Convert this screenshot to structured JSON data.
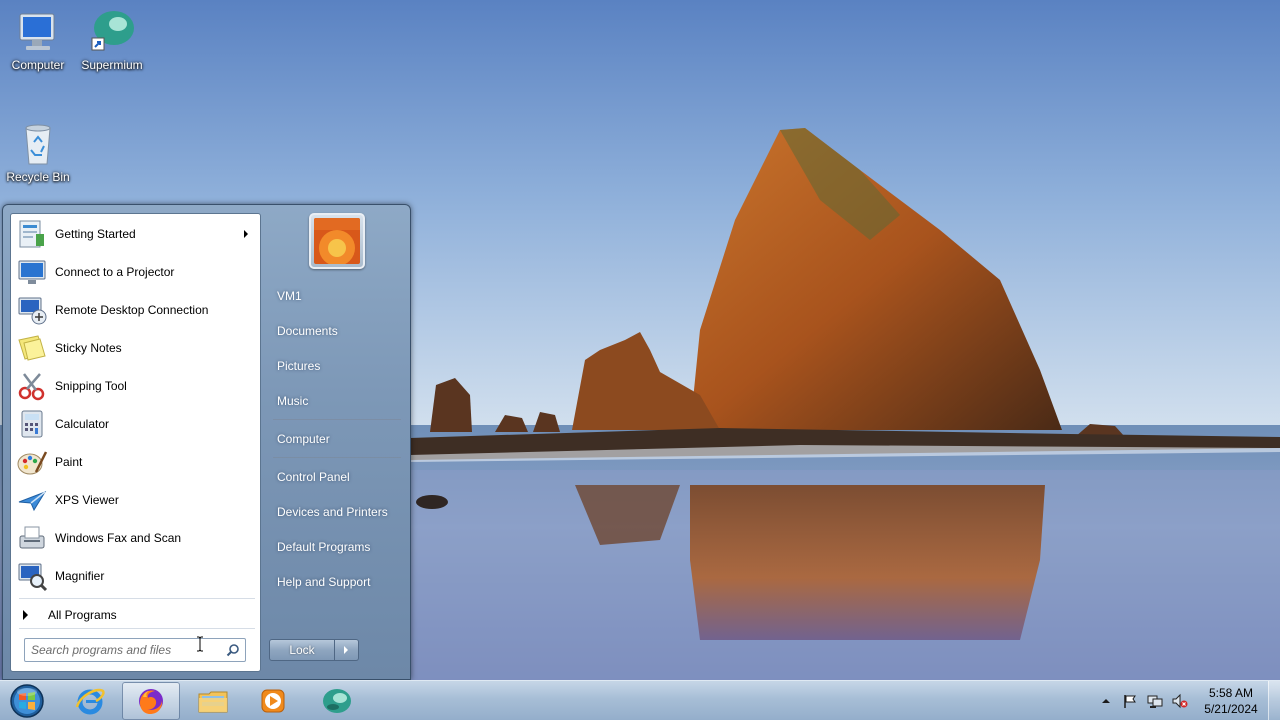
{
  "desktop": {
    "icons": [
      {
        "label": "Computer",
        "icon": "computer-icon"
      },
      {
        "label": "Supermium",
        "icon": "supermium-icon"
      },
      {
        "label": "Recycle Bin",
        "icon": "recycle-bin-icon"
      }
    ]
  },
  "start_menu": {
    "programs": [
      {
        "label": "Getting Started",
        "icon": "getting-started-icon",
        "has_submenu": true
      },
      {
        "label": "Connect to a Projector",
        "icon": "projector-icon"
      },
      {
        "label": "Remote Desktop Connection",
        "icon": "remote-desktop-icon"
      },
      {
        "label": "Sticky Notes",
        "icon": "sticky-notes-icon"
      },
      {
        "label": "Snipping Tool",
        "icon": "snipping-tool-icon"
      },
      {
        "label": "Calculator",
        "icon": "calculator-icon"
      },
      {
        "label": "Paint",
        "icon": "paint-icon"
      },
      {
        "label": "XPS Viewer",
        "icon": "xps-viewer-icon"
      },
      {
        "label": "Windows Fax and Scan",
        "icon": "fax-scan-icon"
      },
      {
        "label": "Magnifier",
        "icon": "magnifier-icon"
      }
    ],
    "all_programs": "All Programs",
    "search": {
      "placeholder": "Search programs and files",
      "value": ""
    },
    "user_picture": "flower-user-picture",
    "right_items": [
      {
        "label": "VM1"
      },
      {
        "label": "Documents"
      },
      {
        "label": "Pictures"
      },
      {
        "label": "Music"
      },
      {
        "label": "Computer"
      },
      {
        "label": "Control Panel"
      },
      {
        "label": "Devices and Printers"
      },
      {
        "label": "Default Programs"
      },
      {
        "label": "Help and Support"
      }
    ],
    "lock_label": "Lock"
  },
  "taskbar": {
    "pinned": [
      {
        "name": "Internet Explorer",
        "icon": "internet-explorer-icon"
      },
      {
        "name": "Firefox",
        "icon": "firefox-icon",
        "active": true
      },
      {
        "name": "Windows Explorer",
        "icon": "file-explorer-icon"
      },
      {
        "name": "Windows Media Player",
        "icon": "media-player-icon"
      },
      {
        "name": "Supermium",
        "icon": "supermium-icon"
      }
    ],
    "tray_icons": [
      "show-hidden-icons-icon",
      "action-center-flag-icon",
      "network-icon",
      "volume-muted-icon"
    ],
    "clock": {
      "time": "5:58 AM",
      "date": "5/21/2024"
    }
  },
  "colors": {
    "sky_top": "#5b86c4",
    "sky_bottom": "#c7d7e9",
    "taskbar": "#a7bed6",
    "start_menu_frame": "#7d98b7"
  }
}
